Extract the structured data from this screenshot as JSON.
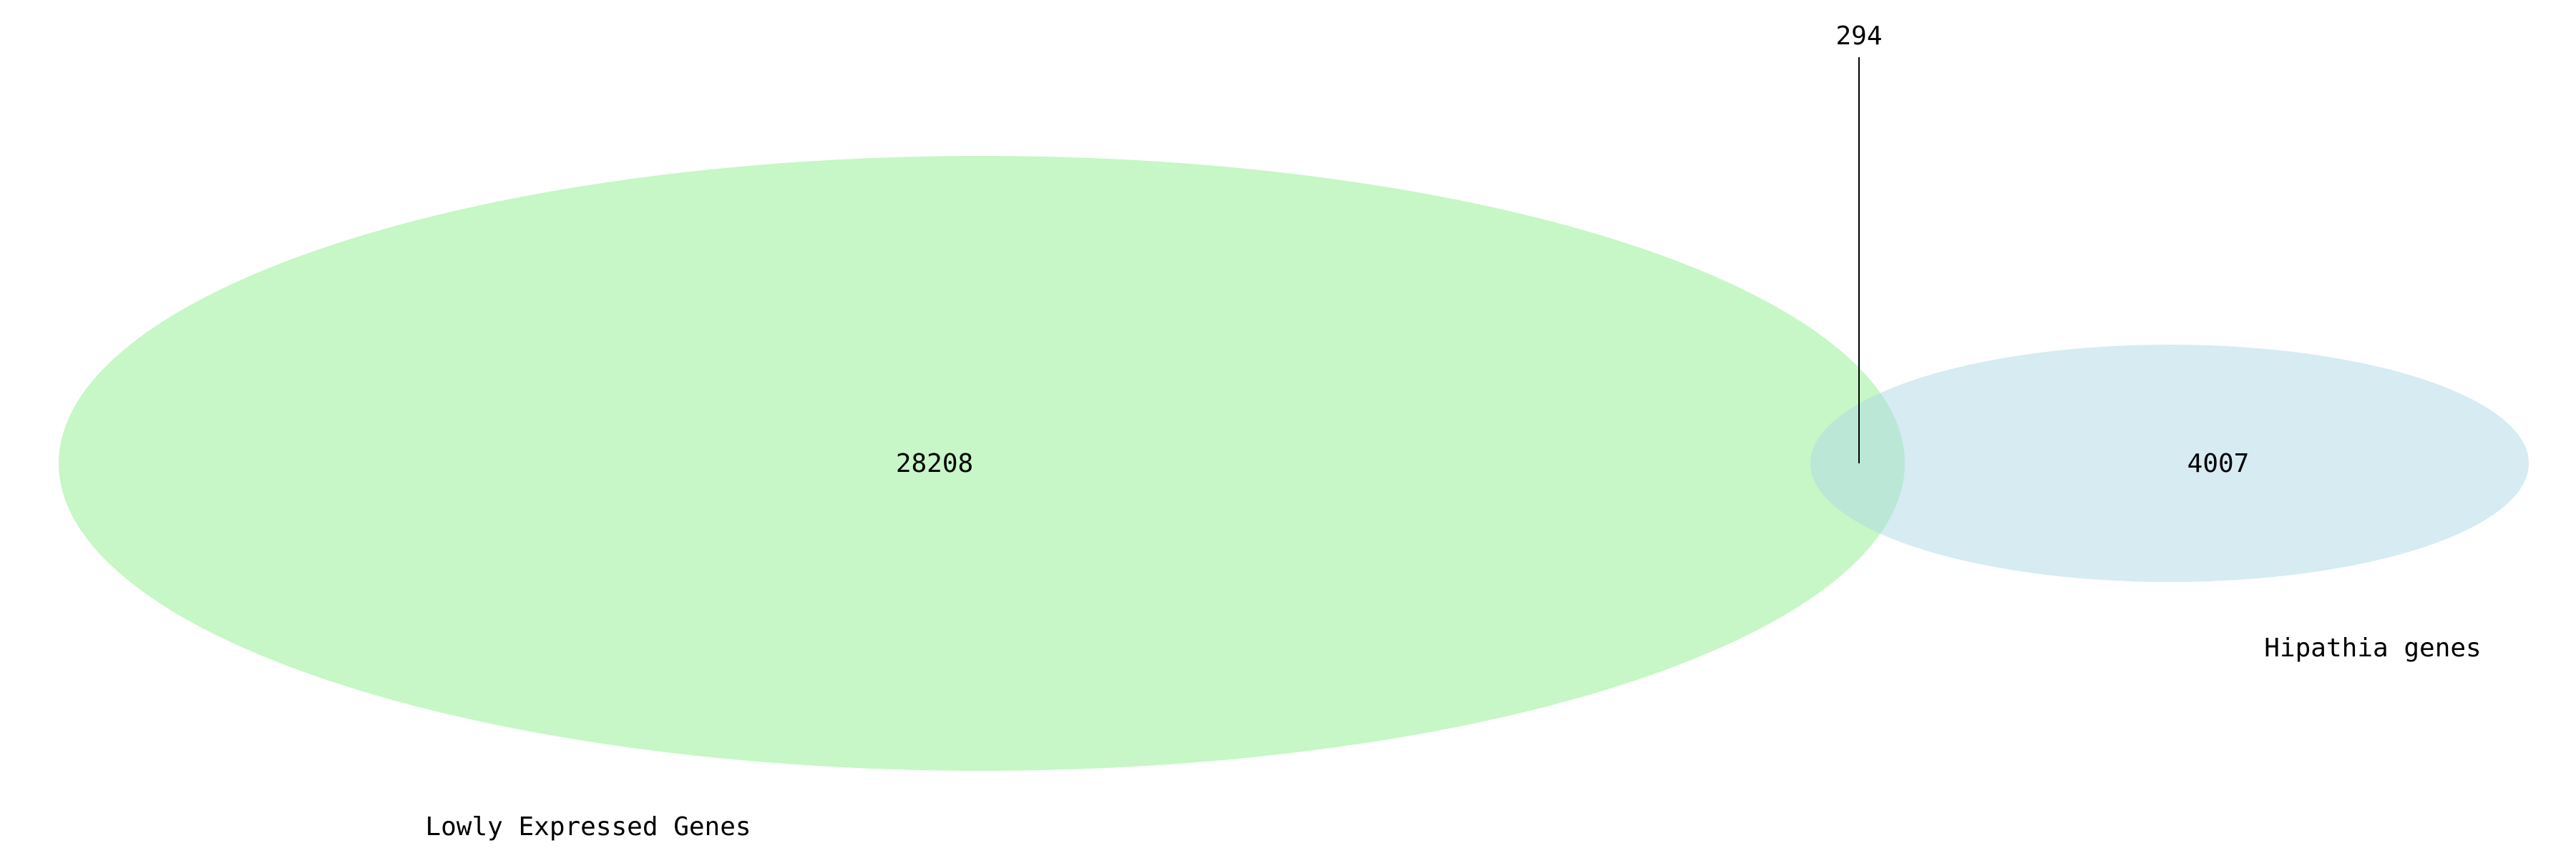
{
  "venn": {
    "sets": [
      {
        "label": "Lowly Expressed Genes",
        "only_count": "28208",
        "color": "#90ee90",
        "opacity": 0.5
      },
      {
        "label": "Hipathia genes",
        "only_count": "4007",
        "color": "#add8e6",
        "opacity": 0.5
      }
    ],
    "intersection_count": "294",
    "leader_line_color": "#000000"
  }
}
